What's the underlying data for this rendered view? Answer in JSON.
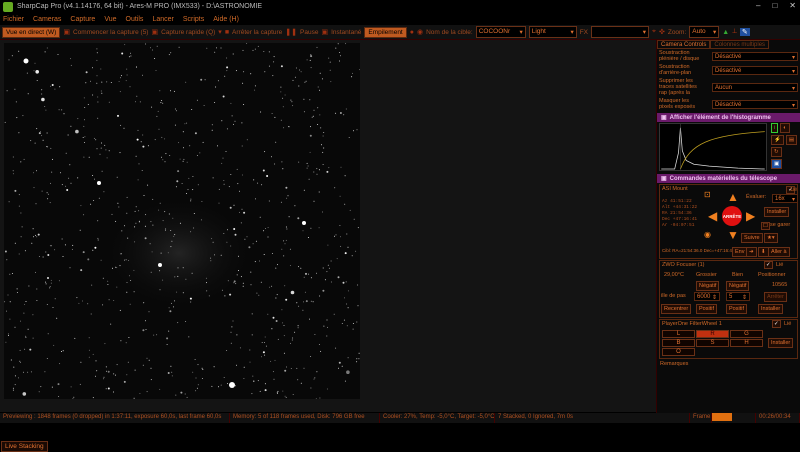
{
  "titlebar": {
    "title": "SharpCap Pro (v4.1.14176, 64 bit) - Ares-M PRO (IMX533) - D:\\ASTRONOMIE",
    "min": "–",
    "max": "□",
    "close": "✕"
  },
  "menu": [
    "Fichier",
    "Cameras",
    "Capture",
    "Vue",
    "Outils",
    "Lancer",
    "Scripts",
    "Aide (H)"
  ],
  "toolbar": {
    "live": "Vue en direct (W)",
    "start_capture": "Commencer la capture (5)",
    "quick_capture": "Capture rapide (Q)",
    "stop_capture": "Arrêter la capture",
    "pause": "Pause",
    "snapshot": "Instantané",
    "stacking": "Empilement",
    "target_label": "Nom de la cible:",
    "target_value": "COCOONr",
    "frame_type": "Light",
    "fx_label": "FX",
    "zoom_label": "Zoom:",
    "zoom_value": "Auto"
  },
  "live_stacking_button": "Live Stacking",
  "statusbar": [
    "Previewing : 1848 frames (0 dropped) in 1:37:11, exposure 60,0s, last frame 60,0s",
    "Memory: 5 of 118 frames used, Disk: 796 GB free",
    "Cooler: 27%, Temp: -5,0°C, Target: -5,0°C",
    "7 Stacked, 0 Ignored, 7m 0s",
    "Frame:",
    "00:26/00:34"
  ],
  "panel": {
    "tabs": [
      "Camera Controls",
      "Colonnes multiples"
    ],
    "rows": [
      {
        "label": "Soustraction plénière / disque",
        "value": "Désactivé"
      },
      {
        "label": "Soustraction d'arrière-plan",
        "value": "Désactivé"
      },
      {
        "label": "Supprimer les traces satellites rap (après la tombée de la nuit)",
        "value": "Aucun"
      },
      {
        "label": "Masquer les pixels exposés",
        "value": "Désactivé"
      }
    ],
    "histogram_title": "Afficher l'élément de l'histogramme",
    "telescope_title": "Commandes matérielles du télescope",
    "mount": {
      "name": "ASI Mount",
      "slew_label": "Évaluer:",
      "slew_value": "16x",
      "install": "Installer",
      "stop": "ARRÊTE",
      "follow": "Suivre",
      "park": "se garer",
      "goto": "Aller à",
      "coords": [
        "Az  41:51:22",
        "Alt +44:31:22",
        "RA  21:54:36",
        "Dec +47:16:41",
        "Ar  -04:07:51"
      ],
      "bottom_coords": "Cibl: RA=21:54:36.0 Dec=+47:16:41",
      "env": "Env"
    },
    "focuser": {
      "name": "ZWO Focuser (1)",
      "link": "Lié",
      "temp": "29,00°C",
      "coarse": "Grossier",
      "fine": "Bien",
      "position_label": "Positionner",
      "position": "10565",
      "negative": "Négatif",
      "negative2": "Négatif",
      "stop": "Arrêter",
      "step_label": "ille de pas",
      "step": "6000",
      "step2": "5",
      "recenter": "Recentrer",
      "positive": "Positif",
      "positive2": "Positif",
      "install": "Installer"
    },
    "filterwheel": {
      "name": "PlayerOne FilterWheel 1",
      "link": "Lié",
      "filters": [
        "L",
        "R",
        "G",
        "B",
        "S",
        "H",
        "O"
      ],
      "selected": "R",
      "install": "Installer"
    },
    "remarks": "Remarques"
  },
  "accent_colors": {
    "text": "#e07030",
    "header": "#6a1a6a",
    "stop": "#d02010"
  }
}
